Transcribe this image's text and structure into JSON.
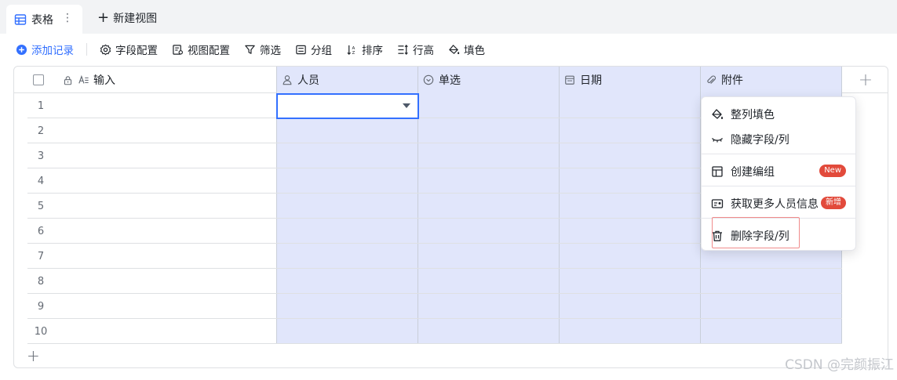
{
  "tabs": {
    "active_label": "表格",
    "more_glyph": "⋮",
    "new_view_label": "新建视图"
  },
  "toolbar": {
    "add_record": "添加记录",
    "field_config": "字段配置",
    "view_config": "视图配置",
    "filter": "筛选",
    "group": "分组",
    "sort": "排序",
    "row_height": "行高",
    "fill_color": "填色"
  },
  "grid": {
    "columns": [
      {
        "label": "输入",
        "icon": "text-field-icon"
      },
      {
        "label": "人员",
        "icon": "person-icon"
      },
      {
        "label": "单选",
        "icon": "single-select-icon"
      },
      {
        "label": "日期",
        "icon": "calendar-icon"
      },
      {
        "label": "附件",
        "icon": "attachment-icon"
      }
    ],
    "row_numbers": [
      "1",
      "2",
      "3",
      "4",
      "5",
      "6",
      "7",
      "8",
      "9",
      "10"
    ],
    "accent": "#3370ff",
    "selected_column_bg": "#e1e6fb"
  },
  "context_menu": {
    "fill_column": "整列填色",
    "hide_field": "隐藏字段/列",
    "create_group": "创建编组",
    "create_group_badge": "New",
    "more_person_info": "获取更多人员信息",
    "more_person_info_badge": "新增",
    "delete_field": "删除字段/列"
  },
  "watermark": "CSDN @完颜振江"
}
